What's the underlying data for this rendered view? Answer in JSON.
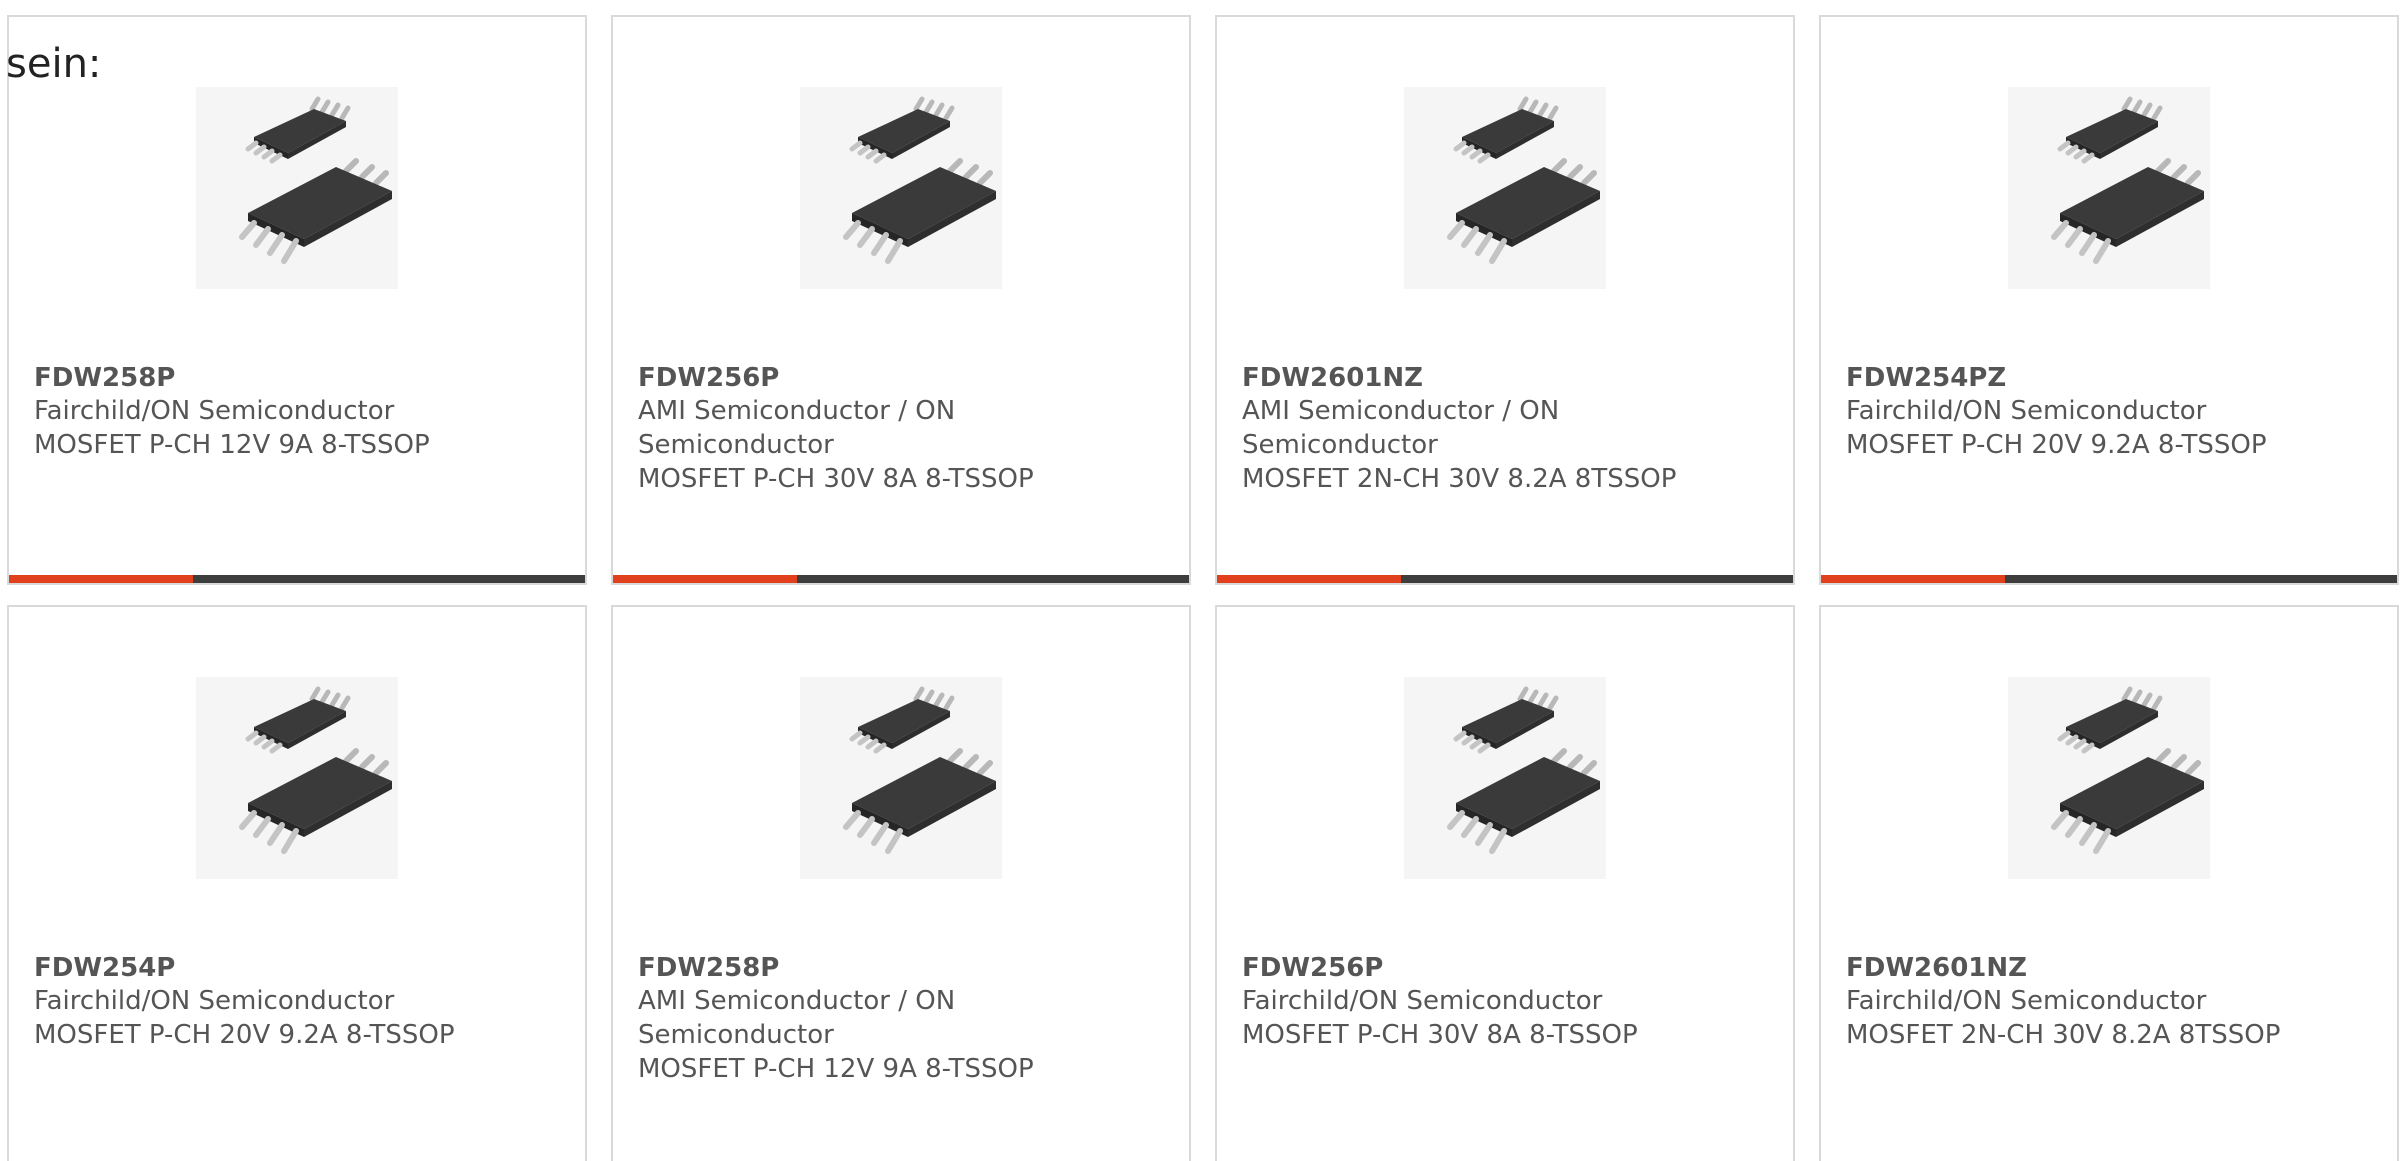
{
  "intro_text": "sein:",
  "colors": {
    "accent": "#e0401b",
    "track": "#3d3d3d",
    "text": "#555555",
    "border": "#d9d9d9"
  },
  "products": [
    {
      "part": "FDW258P",
      "maker": "Fairchild/ON Semiconductor",
      "desc": "MOSFET P-CH 12V 9A 8-TSSOP",
      "image_icon": "tssop-8-chip-image",
      "progress": 0.32
    },
    {
      "part": "FDW256P",
      "maker": "AMI Semiconductor / ON Semiconductor",
      "desc": "MOSFET P-CH 30V 8A 8-TSSOP",
      "image_icon": "tssop-8-chip-image",
      "progress": 0.32
    },
    {
      "part": "FDW2601NZ",
      "maker": "AMI Semiconductor / ON Semiconductor",
      "desc": "MOSFET 2N-CH 30V 8.2A 8TSSOP",
      "image_icon": "tssop-8-chip-image",
      "progress": 0.32
    },
    {
      "part": "FDW254PZ",
      "maker": "Fairchild/ON Semiconductor",
      "desc": "MOSFET P-CH 20V 9.2A 8-TSSOP",
      "image_icon": "tssop-8-chip-image",
      "progress": 0.32
    },
    {
      "part": "FDW254P",
      "maker": "Fairchild/ON Semiconductor",
      "desc": "MOSFET P-CH 20V 9.2A 8-TSSOP",
      "image_icon": "tssop-8-chip-image"
    },
    {
      "part": "FDW258P",
      "maker": "AMI Semiconductor / ON Semiconductor",
      "desc": "MOSFET P-CH 12V 9A 8-TSSOP",
      "image_icon": "tssop-8-chip-image"
    },
    {
      "part": "FDW256P",
      "maker": "Fairchild/ON Semiconductor",
      "desc": "MOSFET P-CH 30V 8A 8-TSSOP",
      "image_icon": "tssop-8-chip-image"
    },
    {
      "part": "FDW2601NZ",
      "maker": "Fairchild/ON Semiconductor",
      "desc": "MOSFET 2N-CH 30V 8.2A 8TSSOP",
      "image_icon": "tssop-8-chip-image"
    }
  ]
}
